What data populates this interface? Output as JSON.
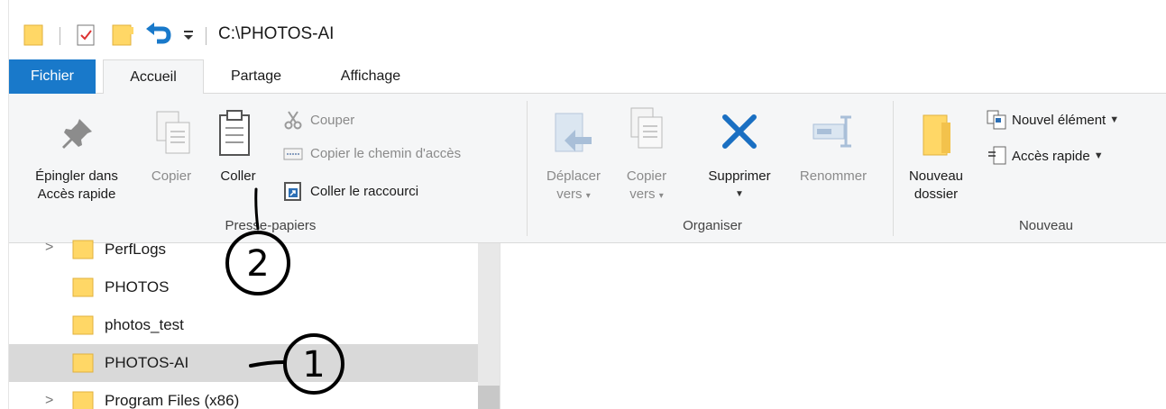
{
  "window": {
    "title_path": "C:\\PHOTOS-AI"
  },
  "tabs": {
    "file": "Fichier",
    "home": "Accueil",
    "share": "Partage",
    "view": "Affichage"
  },
  "ribbon": {
    "clipboard": {
      "group_label": "Presse-papiers",
      "pin_line1": "Épingler dans",
      "pin_line2": "Accès rapide",
      "copy": "Copier",
      "paste": "Coller",
      "cut": "Couper",
      "copy_path": "Copier le chemin d'accès",
      "paste_shortcut": "Coller le raccourci"
    },
    "organize": {
      "group_label": "Organiser",
      "move_line1": "Déplacer",
      "move_line2": "vers",
      "copyto_line1": "Copier",
      "copyto_line2": "vers",
      "delete": "Supprimer",
      "rename": "Renommer"
    },
    "new": {
      "group_label": "Nouveau",
      "new_folder_line1": "Nouveau",
      "new_folder_line2": "dossier",
      "new_item": "Nouvel élément",
      "easy_access": "Accès rapide"
    }
  },
  "nav": {
    "items": [
      {
        "label": "PerfLogs"
      },
      {
        "label": "PHOTOS"
      },
      {
        "label": "photos_test"
      },
      {
        "label": "PHOTOS-AI"
      },
      {
        "label": "Program Files (x86)"
      }
    ]
  },
  "annotations": {
    "one": "1",
    "two": "2"
  },
  "colors": {
    "file_tab": "#1979ca",
    "folder": "#ffd766",
    "delete_x": "#1a6fc2",
    "selection": "#d9d9d9"
  }
}
